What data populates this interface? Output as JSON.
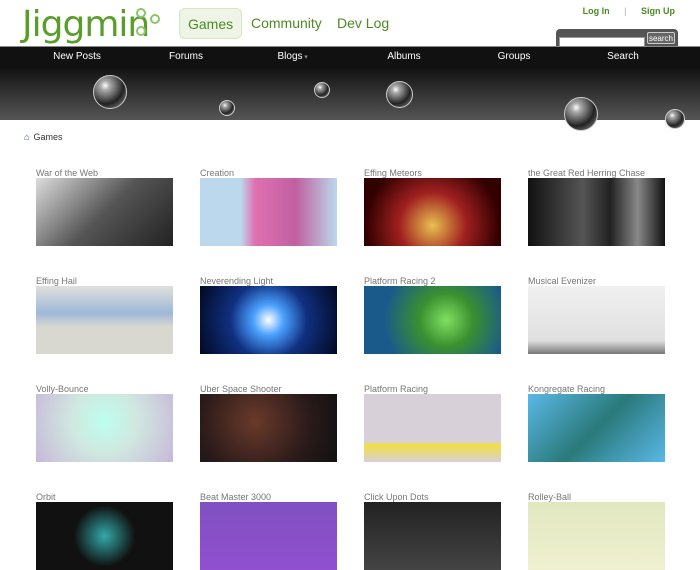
{
  "logo": "Jiggmin",
  "tabs": [
    "Games",
    "Community",
    "Dev Log"
  ],
  "top_links": {
    "login": "Log In",
    "sep": "|",
    "signup": "Sign Up"
  },
  "search": {
    "button": "search",
    "value": ""
  },
  "nav": [
    "New Posts",
    "Forums",
    "Blogs",
    "Albums",
    "Groups",
    "Search"
  ],
  "breadcrumb": "Games",
  "games": [
    {
      "title": "War of the Web",
      "bg": "linear-gradient(135deg,#ddd,#555 50%,#222)"
    },
    {
      "title": "Creation",
      "bg": "linear-gradient(90deg,#bcd8ec 30%,#e070b0 40%,#c060a0 70%,#bcd8ec)"
    },
    {
      "title": "Effing Meteors",
      "bg": "radial-gradient(circle at 50% 70%,#e8c050,#a02020 40%,#300 80%)"
    },
    {
      "title": "the Great Red Herring Chase",
      "bg": "linear-gradient(90deg,#111,#555 40%,#222 60%,#888 80%,#111)"
    },
    {
      "title": "Effing Hail",
      "bg": "linear-gradient(#e0e0dc,#9eb8d8 40%,#d8d8d0 60%)"
    },
    {
      "title": "Neverending Light",
      "bg": "radial-gradient(circle at 50% 50%,#fff,#4aa0ff 20%,#103080 50%,#020820)"
    },
    {
      "title": "Platform Racing 2",
      "bg": "radial-gradient(circle at 60% 50%,#80e060,#3a9030 30%,#1a5a8a 70%)"
    },
    {
      "title": "Musical Evenizer",
      "bg": "linear-gradient(#f0f0f0,#e0e0e0 80%,#777)"
    },
    {
      "title": "Volly-Bounce",
      "bg": "radial-gradient(circle at 50% 40%,#bfe,#d0e8e0 40%,#c8b8d8)"
    },
    {
      "title": "Uber Space Shooter",
      "bg": "radial-gradient(circle at 40% 40%,#6a3a2a,#2a1a1a 60%,#111)"
    },
    {
      "title": "Platform Racing",
      "bg": "linear-gradient(#d8d0d8 70%,#f0e040 75%,#d8d0d8)"
    },
    {
      "title": "Kongregate Racing",
      "bg": "linear-gradient(135deg,#5ab8e8,#2a7a7a 50%,#5ab8e8)"
    },
    {
      "title": "Orbit",
      "bg": "radial-gradient(circle,#3aa,#111 40%)"
    },
    {
      "title": "Beat Master 3000",
      "bg": "linear-gradient(#8050c0,#9050d0)"
    },
    {
      "title": "Click Upon Dots",
      "bg": "linear-gradient(#222,#444)"
    },
    {
      "title": "Rolley-Ball",
      "bg": "linear-gradient(#e0e8c0,#f0f0d0)"
    }
  ]
}
